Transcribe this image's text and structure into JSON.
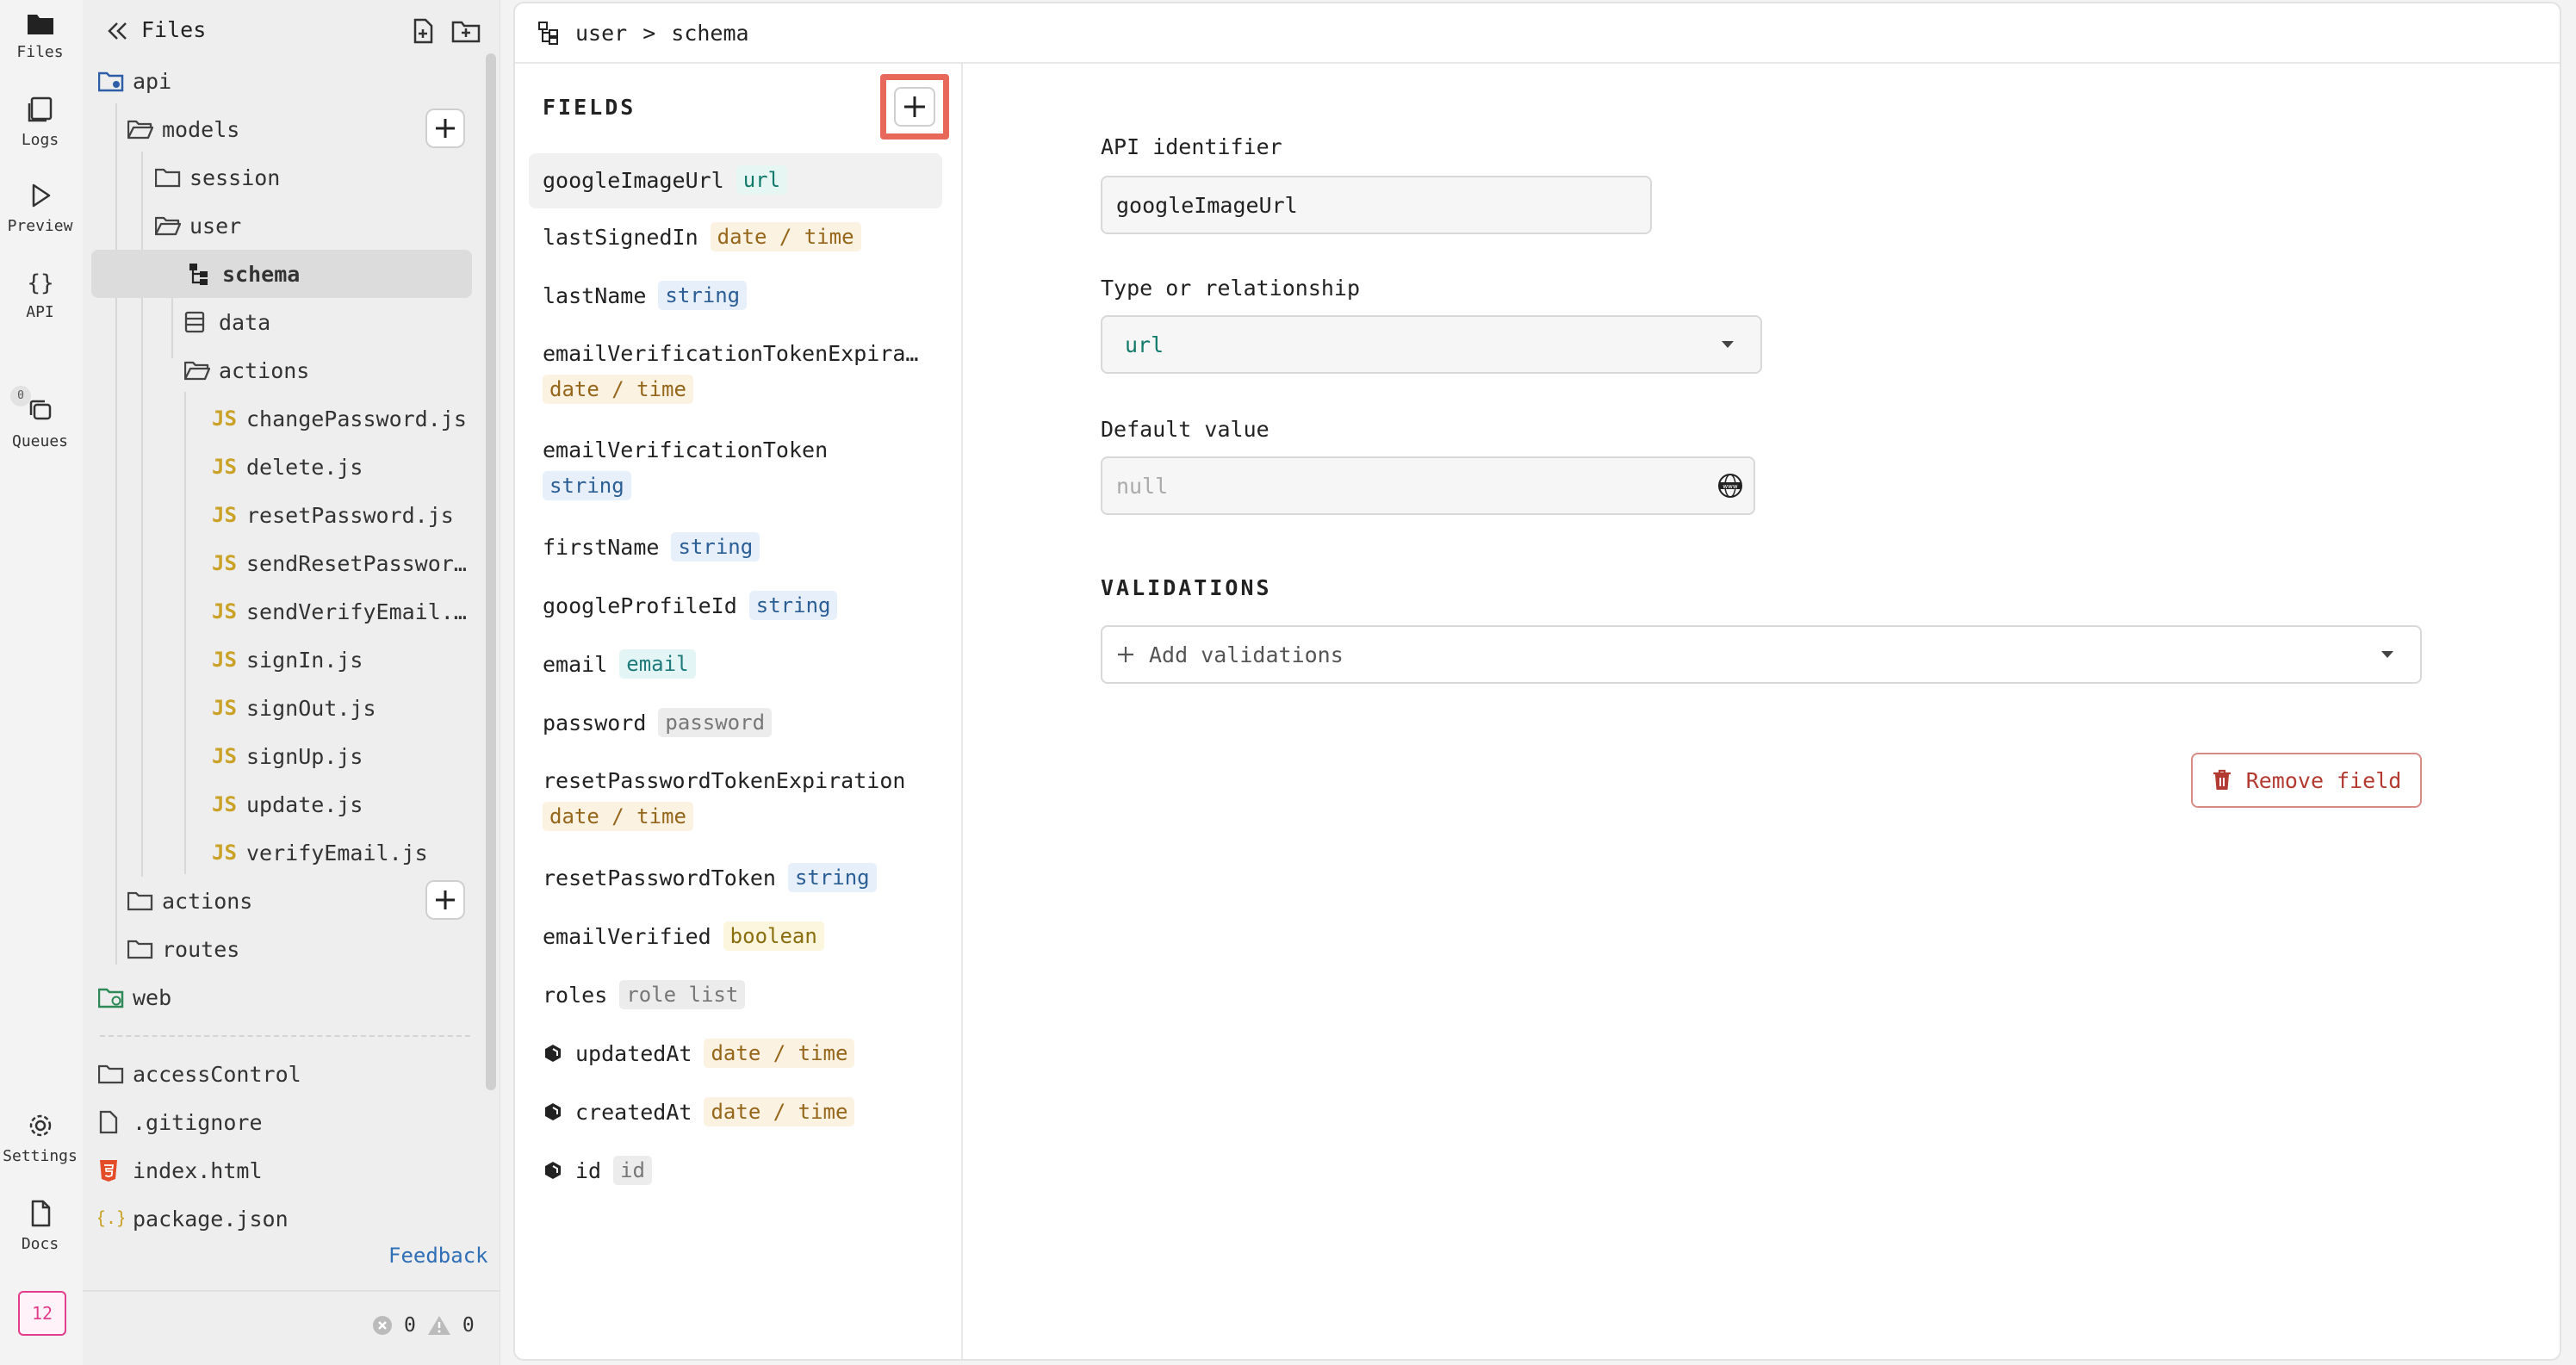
{
  "rail": {
    "items": [
      {
        "label": "Files",
        "icon": "folder-icon"
      },
      {
        "label": "Logs",
        "icon": "logs-icon"
      },
      {
        "label": "Preview",
        "icon": "play-icon"
      },
      {
        "label": "API",
        "icon": "braces-icon"
      },
      {
        "label": "Queues",
        "icon": "queues-icon"
      },
      {
        "label": "Settings",
        "icon": "gear-icon"
      },
      {
        "label": "Docs",
        "icon": "doc-icon"
      }
    ],
    "queues_badge": "0",
    "notifications_count": "12"
  },
  "files": {
    "title": "Files",
    "tree": [
      {
        "label": "api"
      },
      {
        "label": "models"
      },
      {
        "label": "session"
      },
      {
        "label": "user"
      },
      {
        "label": "schema"
      },
      {
        "label": "data"
      },
      {
        "label": "actions"
      },
      {
        "label": "changePassword.js"
      },
      {
        "label": "delete.js"
      },
      {
        "label": "resetPassword.js"
      },
      {
        "label": "sendResetPasswor…"
      },
      {
        "label": "sendVerifyEmail.…"
      },
      {
        "label": "signIn.js"
      },
      {
        "label": "signOut.js"
      },
      {
        "label": "signUp.js"
      },
      {
        "label": "update.js"
      },
      {
        "label": "verifyEmail.js"
      },
      {
        "label": "actions"
      },
      {
        "label": "routes"
      },
      {
        "label": "web"
      }
    ],
    "root_files": [
      {
        "label": "accessControl"
      },
      {
        "label": ".gitignore"
      },
      {
        "label": "index.html"
      },
      {
        "label": "package.json"
      }
    ],
    "js_badge": "JS",
    "feedback": "Feedback",
    "errors": "0",
    "warnings": "0"
  },
  "breadcrumb": {
    "parent": "user",
    "separator": ">",
    "current": "schema"
  },
  "fields": {
    "title": "FIELDS",
    "items": [
      {
        "name": "googleImageUrl",
        "type": "url"
      },
      {
        "name": "lastSignedIn",
        "type": "date / time"
      },
      {
        "name": "lastName",
        "type": "string"
      },
      {
        "name": "emailVerificationTokenExpira…",
        "type": "date / time"
      },
      {
        "name": "emailVerificationToken",
        "type": "string"
      },
      {
        "name": "firstName",
        "type": "string"
      },
      {
        "name": "googleProfileId",
        "type": "string"
      },
      {
        "name": "email",
        "type": "email"
      },
      {
        "name": "password",
        "type": "password"
      },
      {
        "name": "resetPasswordTokenExpiration",
        "type": "date / time"
      },
      {
        "name": "resetPasswordToken",
        "type": "string"
      },
      {
        "name": "emailVerified",
        "type": "boolean"
      },
      {
        "name": "roles",
        "type": "role list"
      },
      {
        "name": "updatedAt",
        "type": "date / time"
      },
      {
        "name": "createdAt",
        "type": "date / time"
      },
      {
        "name": "id",
        "type": "id"
      }
    ]
  },
  "detail": {
    "api_identifier_label": "API identifier",
    "api_identifier_value": "googleImageUrl",
    "type_label": "Type or relationship",
    "type_value": "url",
    "default_label": "Default value",
    "default_placeholder": "null",
    "validations_title": "VALIDATIONS",
    "add_validations": "Add validations",
    "remove_field": "Remove field"
  }
}
